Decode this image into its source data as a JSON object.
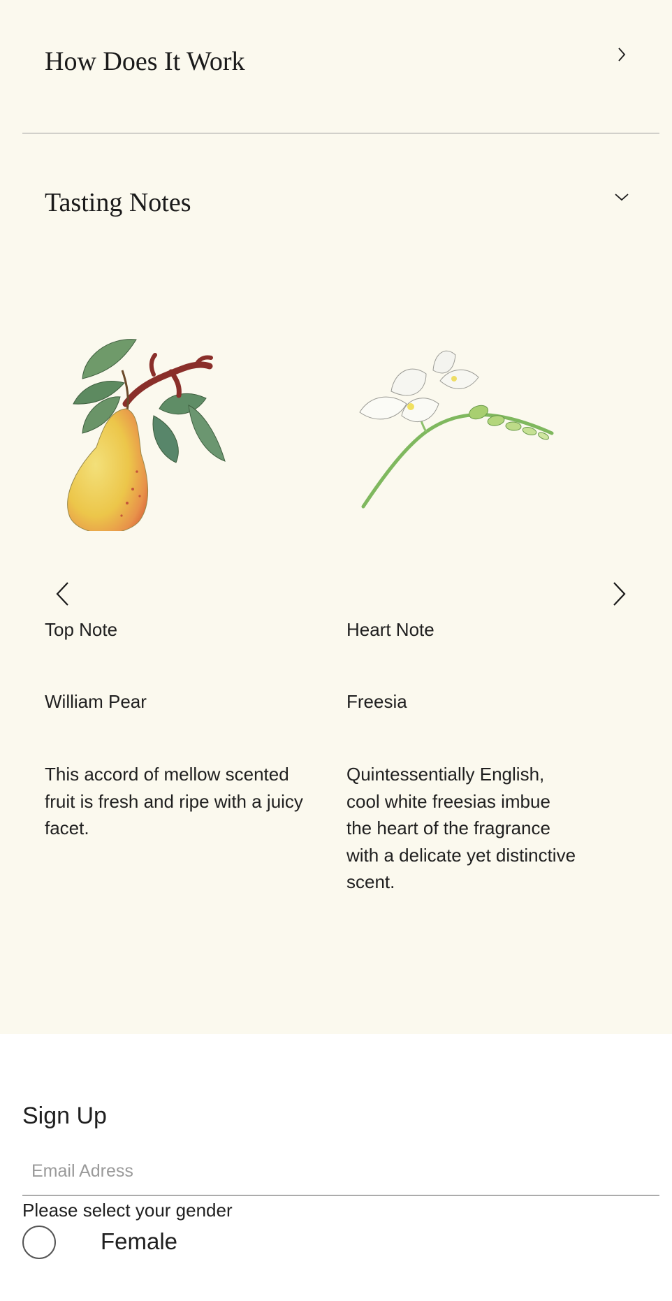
{
  "accordion": {
    "how_it_works": {
      "title": "How Does It Work",
      "state": "collapsed",
      "icon": "chevron-right-icon"
    },
    "tasting_notes": {
      "title": "Tasting Notes",
      "state": "expanded",
      "icon": "chevron-down-icon"
    }
  },
  "carousel": {
    "prev_icon": "chevron-left-icon",
    "next_icon": "chevron-right-icon",
    "notes": [
      {
        "label": "Top Note",
        "name": "William Pear",
        "description": "This accord of mellow scented fruit is fresh and ripe with a juicy facet.",
        "image": "pear-illustration"
      },
      {
        "label": "Heart Note",
        "name": "Freesia",
        "description": "Quintessentially English, cool white freesias imbue the heart of the fragrance with a delicate yet distinctive scent.",
        "image": "freesia-illustration"
      }
    ]
  },
  "signup": {
    "title": "Sign Up",
    "email_placeholder": "Email Adress",
    "email_value": "",
    "gender_prompt": "Please select your gender",
    "gender_option": "Female",
    "gender_selected": false
  },
  "colors": {
    "background": "#fbf9ee",
    "text": "#1a1a1a",
    "divider": "#9a9a9a"
  }
}
